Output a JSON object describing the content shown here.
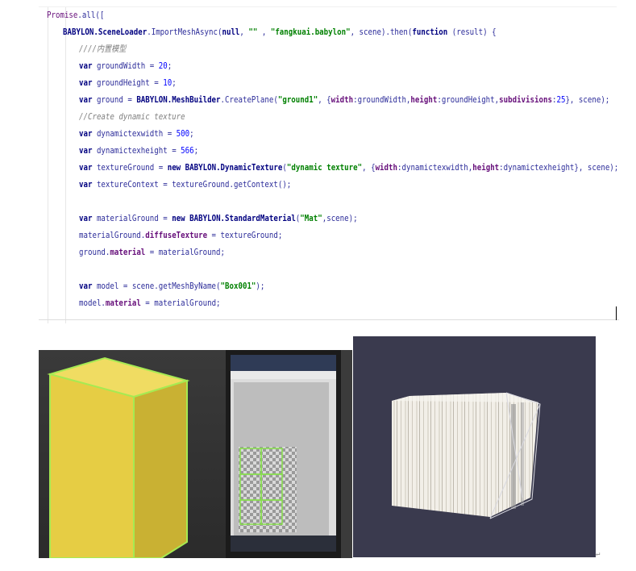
{
  "code": {
    "lines": [
      {
        "indent": 0,
        "tokens": [
          [
            "id",
            "Promise"
          ],
          [
            "plain",
            ".all(["
          ]
        ]
      },
      {
        "indent": 1,
        "tokens": [
          [
            "cls",
            "BABYLON.SceneLoader"
          ],
          [
            "plain",
            ".ImportMeshAsync("
          ],
          [
            "kw",
            "null"
          ],
          [
            "plain",
            ", "
          ],
          [
            "str",
            "\"\""
          ],
          [
            "plain",
            " , "
          ],
          [
            "str",
            "\"fangkuai.babylon\""
          ],
          [
            "plain",
            ", scene).then("
          ],
          [
            "kw",
            "function"
          ],
          [
            "plain",
            " (result) {"
          ]
        ]
      },
      {
        "indent": 2,
        "tokens": [
          [
            "cm",
            "////内置模型"
          ]
        ]
      },
      {
        "indent": 2,
        "tokens": [
          [
            "kw",
            "var"
          ],
          [
            "plain",
            " groundWidth = "
          ],
          [
            "num",
            "20"
          ],
          [
            "plain",
            ";"
          ]
        ]
      },
      {
        "indent": 2,
        "tokens": [
          [
            "kw",
            "var"
          ],
          [
            "plain",
            " groundHeight = "
          ],
          [
            "num",
            "10"
          ],
          [
            "plain",
            ";"
          ]
        ]
      },
      {
        "indent": 2,
        "tokens": [
          [
            "kw",
            "var"
          ],
          [
            "plain",
            " ground = "
          ],
          [
            "cls",
            "BABYLON.MeshBuilder"
          ],
          [
            "plain",
            ".CreatePlane("
          ],
          [
            "str",
            "\"ground1\""
          ],
          [
            "plain",
            ", {"
          ],
          [
            "fld",
            "width"
          ],
          [
            "plain",
            ":groundWidth,"
          ],
          [
            "fld",
            "height"
          ],
          [
            "plain",
            ":groundHeight,"
          ],
          [
            "fld",
            "subdivisions"
          ],
          [
            "plain",
            ":"
          ],
          [
            "num",
            "25"
          ],
          [
            "plain",
            "}, scene);"
          ]
        ]
      },
      {
        "indent": 2,
        "tokens": [
          [
            "cm",
            "//Create dynamic texture"
          ]
        ]
      },
      {
        "indent": 2,
        "tokens": [
          [
            "kw",
            "var"
          ],
          [
            "plain",
            " dynamictexwidth = "
          ],
          [
            "num",
            "500"
          ],
          [
            "plain",
            ";"
          ]
        ]
      },
      {
        "indent": 2,
        "tokens": [
          [
            "kw",
            "var"
          ],
          [
            "plain",
            " dynamictexheight = "
          ],
          [
            "num",
            "566"
          ],
          [
            "plain",
            ";"
          ]
        ]
      },
      {
        "indent": 2,
        "tokens": [
          [
            "kw",
            "var"
          ],
          [
            "plain",
            " textureGround = "
          ],
          [
            "kw",
            "new"
          ],
          [
            "plain",
            " "
          ],
          [
            "cls",
            "BABYLON.DynamicTexture"
          ],
          [
            "plain",
            "("
          ],
          [
            "str",
            "\"dynamic texture\""
          ],
          [
            "plain",
            ", {"
          ],
          [
            "fld",
            "width"
          ],
          [
            "plain",
            ":dynamictexwidth,"
          ],
          [
            "fld",
            "height"
          ],
          [
            "plain",
            ":dynamictexheight}, scene);"
          ]
        ]
      },
      {
        "indent": 2,
        "tokens": [
          [
            "kw",
            "var"
          ],
          [
            "plain",
            " textureContext = textureGround.getContext();"
          ]
        ]
      },
      {
        "indent": 2,
        "tokens": []
      },
      {
        "indent": 2,
        "tokens": [
          [
            "kw",
            "var"
          ],
          [
            "plain",
            " materialGround = "
          ],
          [
            "kw",
            "new"
          ],
          [
            "plain",
            " "
          ],
          [
            "cls",
            "BABYLON.StandardMaterial"
          ],
          [
            "plain",
            "("
          ],
          [
            "str",
            "\"Mat\""
          ],
          [
            "plain",
            ",scene);"
          ]
        ]
      },
      {
        "indent": 2,
        "tokens": [
          [
            "plain",
            "materialGround."
          ],
          [
            "fld",
            "diffuseTexture"
          ],
          [
            "plain",
            " = textureGround;"
          ]
        ]
      },
      {
        "indent": 2,
        "tokens": [
          [
            "plain",
            "ground."
          ],
          [
            "fld",
            "material"
          ],
          [
            "plain",
            " = materialGround;"
          ]
        ]
      },
      {
        "indent": 2,
        "tokens": []
      },
      {
        "indent": 2,
        "tokens": [
          [
            "kw",
            "var"
          ],
          [
            "plain",
            " model = scene.getMeshByName("
          ],
          [
            "str",
            "\"Box001\""
          ],
          [
            "plain",
            ");"
          ]
        ]
      },
      {
        "indent": 2,
        "tokens": [
          [
            "plain",
            "model."
          ],
          [
            "fld",
            "material"
          ],
          [
            "plain",
            " = materialGround;"
          ]
        ]
      }
    ]
  },
  "colors": {
    "yellow_box": "#e9d24a",
    "green_edge": "#9ee24a",
    "render_bg": "#3a3a4e",
    "box_white": "#f2efe8"
  },
  "icons": [
    "paragraph-mark-icon"
  ],
  "paragraph_mark": "↵"
}
